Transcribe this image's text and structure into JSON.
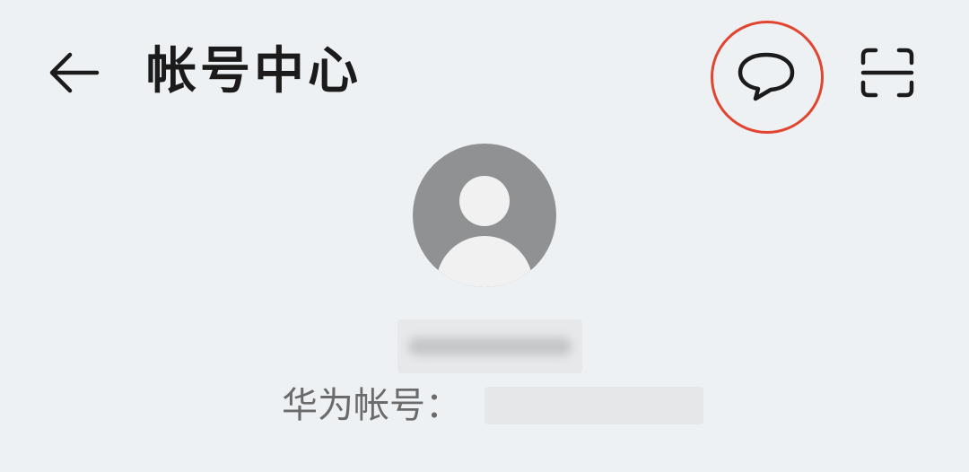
{
  "header": {
    "title": "帐号中心",
    "back_icon": "arrow-left-icon",
    "feedback_icon": "speech-bubble-icon",
    "scan_icon": "scan-frame-icon",
    "highlight_color": "#e2452f"
  },
  "profile": {
    "avatar_icon": "default-user-avatar-icon",
    "username": "",
    "account_label": "华为帐号：",
    "account_value": ""
  },
  "colors": {
    "background": "#eef1f4",
    "avatar": "#8f9193",
    "title_text": "#1b1b1b",
    "label_text": "#6b6b6b"
  }
}
